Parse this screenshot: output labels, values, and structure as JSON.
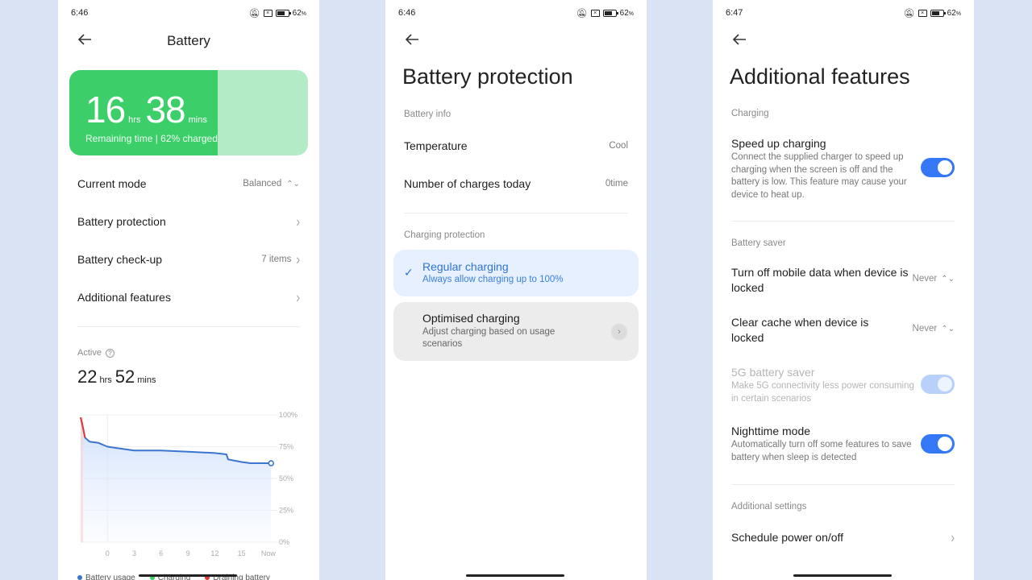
{
  "screens": [
    {
      "status": {
        "time": "6:46",
        "battery_pct": "62",
        "battery_level": 0.62
      },
      "header": {
        "title": "Battery"
      },
      "battery_card": {
        "hours": "16",
        "hours_unit": "hrs",
        "minutes": "38",
        "minutes_unit": "mins",
        "subtitle": "Remaining time | 62% charged",
        "charge_fraction": 0.62,
        "colors": {
          "fill": "#3ccf69",
          "track": "#b3ebc6"
        }
      },
      "menu": [
        {
          "label": "Current mode",
          "value": "Balanced",
          "icon": "updown-icon"
        },
        {
          "label": "Battery protection",
          "value": "",
          "icon": "chevron-right-icon"
        },
        {
          "label": "Battery check-up",
          "value": "7 items",
          "icon": "chevron-right-icon"
        },
        {
          "label": "Additional features",
          "value": "",
          "icon": "chevron-right-icon"
        }
      ],
      "active": {
        "label": "Active",
        "hours": "22",
        "hours_unit": "hrs",
        "minutes": "52",
        "minutes_unit": "mins"
      },
      "legend": [
        {
          "label": "Battery usage",
          "color": "#3a75d0"
        },
        {
          "label": "Charging",
          "color": "#3ccf69"
        },
        {
          "label": "Draining battery",
          "color": "#e53935"
        }
      ]
    },
    {
      "status": {
        "time": "6:46",
        "battery_pct": "62"
      },
      "header": {
        "title": "Battery protection"
      },
      "battery_info": {
        "section": "Battery info",
        "rows": [
          {
            "label": "Temperature",
            "value": "Cool"
          },
          {
            "label": "Number of charges today",
            "value": "0time"
          }
        ]
      },
      "charging_protection": {
        "section": "Charging protection",
        "options": [
          {
            "title": "Regular charging",
            "desc": "Always allow charging up to 100%",
            "selected": true
          },
          {
            "title": "Optimised charging",
            "desc": "Adjust charging based on usage scenarios",
            "selected": false
          }
        ]
      }
    },
    {
      "status": {
        "time": "6:47",
        "battery_pct": "62"
      },
      "header": {
        "title": "Additional features"
      },
      "sections": {
        "charging": "Charging",
        "battery_saver": "Battery saver",
        "additional_settings": "Additional settings"
      },
      "speed_up": {
        "title": "Speed up charging",
        "desc": "Connect the supplied charger to speed up charging when the screen is off and the battery is low. This feature may cause your device to heat up.",
        "enabled": true
      },
      "mobile_data": {
        "title": "Turn off mobile data when device is locked",
        "value": "Never"
      },
      "clear_cache": {
        "title": "Clear cache when device is locked",
        "value": "Never"
      },
      "five_g": {
        "title": "5G battery saver",
        "desc": "Make 5G connectivity less power consuming in certain scenarios",
        "enabled": true,
        "disabled": true
      },
      "nighttime": {
        "title": "Nighttime mode",
        "desc": "Automatically turn off some features to save battery when sleep is detected",
        "enabled": true
      },
      "schedule": {
        "title": "Schedule power on/off"
      }
    }
  ],
  "chart_data": {
    "type": "line",
    "title": "",
    "xlabel": "",
    "ylabel": "",
    "x_tick_labels": [
      "0",
      "3",
      "6",
      "9",
      "12",
      "15",
      "Now"
    ],
    "y_tick_labels": [
      "100%",
      "75%",
      "50%",
      "25%",
      "0%"
    ],
    "ylim": [
      0,
      100
    ],
    "xlim": [
      -3,
      19
    ],
    "series": [
      {
        "name": "Battery usage",
        "color": "#3a75d0",
        "x": [
          -3,
          -2.8,
          -2.5,
          -2,
          -1,
          0,
          1,
          3,
          6,
          9,
          12,
          13.3,
          13.5,
          15,
          16,
          18.3
        ],
        "y": [
          98,
          92,
          82,
          79,
          78,
          75,
          74,
          72,
          72,
          71,
          70,
          69,
          65,
          63,
          62,
          62
        ]
      },
      {
        "name": "Draining battery",
        "color": "#e53935",
        "x": [
          -3,
          -2.8,
          -2.5
        ],
        "y": [
          98,
          92,
          82
        ]
      }
    ]
  }
}
